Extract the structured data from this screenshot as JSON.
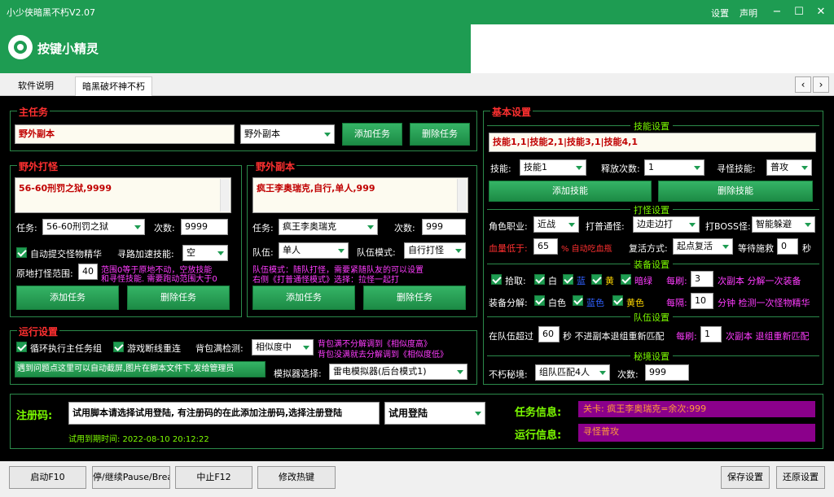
{
  "window": {
    "title": "小少侠暗黑不朽V2.07",
    "settings": "设置",
    "statement": "声明"
  },
  "header": {
    "logo_text": "按键小精灵"
  },
  "tabs": [
    {
      "label": "软件说明"
    },
    {
      "label": "暗黑破坏神不朽"
    }
  ],
  "main_task": {
    "title": "主任务",
    "value": "野外副本",
    "select": "野外副本",
    "add": "添加任务",
    "delete": "删除任务"
  },
  "field_fight": {
    "title": "野外打怪",
    "memo": "56-60刑罚之狱,9999",
    "task_label": "任务:",
    "task_value": "56-60刑罚之狱",
    "count_label": "次数:",
    "count_value": "9999",
    "auto_submit": "自动提交怪物精华",
    "speed_label": "寻路加速技能:",
    "speed_value": "空",
    "range_label": "原地打怪范围:",
    "range_value": "40",
    "range_note1": "范围0等于原地不动，空放技能",
    "range_note2": "和寻怪技能. 需要跑动范围大于0",
    "add": "添加任务",
    "delete": "删除任务"
  },
  "field_dungeon": {
    "title": "野外副本",
    "memo": "疯王李奥瑞克,自行,单人,999",
    "task_label": "任务:",
    "task_value": "疯王李奥瑞克",
    "count_label": "次数:",
    "count_value": "999",
    "team_label": "队伍:",
    "team_value": "单人",
    "mode_label": "队伍模式:",
    "mode_value": "自行打怪",
    "note1": "队伍模式：随队打怪，需要紧随队友的可以设置",
    "note2": "右侧《打普通怪模式》选择：拉怪一起打",
    "add": "添加任务",
    "delete": "删除任务"
  },
  "run_settings": {
    "title": "运行设置",
    "loop": "循环执行主任务组",
    "reconnect": "游戏断线重连",
    "bag_label": "背包满检测:",
    "bag_value": "相似度中",
    "bag_note1": "背包满不分解调到《相似度高》",
    "bag_note2": "背包没满就去分解调到《相似度低》",
    "problem_btn": "遇到问题点这里可以自动截屏,图片在脚本文件下,发给管理员",
    "emulator_label": "模拟器选择:",
    "emulator_value": "雷电模拟器(后台模式1)"
  },
  "basic": {
    "title": "基本设置",
    "skill_section": "技能设置",
    "skill_memo": "技能1,1|技能2,1|技能3,1|技能4,1",
    "skill_label": "技能:",
    "skill_value": "技能1",
    "release_label": "释放次数:",
    "release_value": "1",
    "seek_label": "寻怪技能:",
    "seek_value": "普攻",
    "add_skill": "添加技能",
    "delete_skill": "删除技能",
    "fight_section": "打怪设置",
    "role_label": "角色职业:",
    "role_value": "近战",
    "normal_label": "打普通怪:",
    "normal_value": "边走边打",
    "boss_label": "打BOSS怪:",
    "boss_value": "智能躲避",
    "hp_label": "血量低于:",
    "hp_value": "65",
    "hp_unit": "% 自动吃血瓶",
    "revive_label": "复活方式:",
    "revive_value": "起点复活",
    "wait_label": "等待施救",
    "wait_value": "0",
    "wait_unit": "秒",
    "equip_section": "装备设置",
    "pickup_label": "拾取:",
    "white": "白",
    "blue": "蓝",
    "yellow": "黄",
    "green": "暗绿",
    "every_label": "每刷:",
    "every_value": "3",
    "every_unit": "次副本 分解一次装备",
    "decompose_label": "装备分解:",
    "white2": "白色",
    "blue2": "蓝色",
    "yellow2": "黄色",
    "interval_label": "每隔:",
    "interval_value": "10",
    "interval_unit": "分钟 检测一次怪物精华",
    "team_section": "队伍设置",
    "team_over_label": "在队伍超过",
    "team_over_value": "60",
    "team_over_unit": "秒 不进副本退组重新匹配",
    "team_every_label": "每刷:",
    "team_every_value": "1",
    "team_every_unit": "次副本 退组重新匹配",
    "secret_section": "秘境设置",
    "secret_label": "不朽秘境:",
    "secret_value": "组队匹配4人",
    "secret_count_label": "次数:",
    "secret_count_value": "999"
  },
  "register": {
    "label": "注册码:",
    "value": "试用脚本请选择试用登陆, 有注册码的在此添加注册码,选择注册登陆",
    "login_value": "试用登陆",
    "expire": "试用到期时间: 2022-08-10 20:12:22"
  },
  "info": {
    "task_label": "任务信息:",
    "task_value": "关卡: 疯王李奥瑞克=余次:999",
    "run_label": "运行信息:",
    "run_value": "寻怪普攻"
  },
  "bottom": {
    "start": "启动F10",
    "pause": "停/继续Pause/Break",
    "stop": "中止F12",
    "hotkey": "修改热键",
    "save": "保存设置",
    "restore": "还原设置"
  }
}
